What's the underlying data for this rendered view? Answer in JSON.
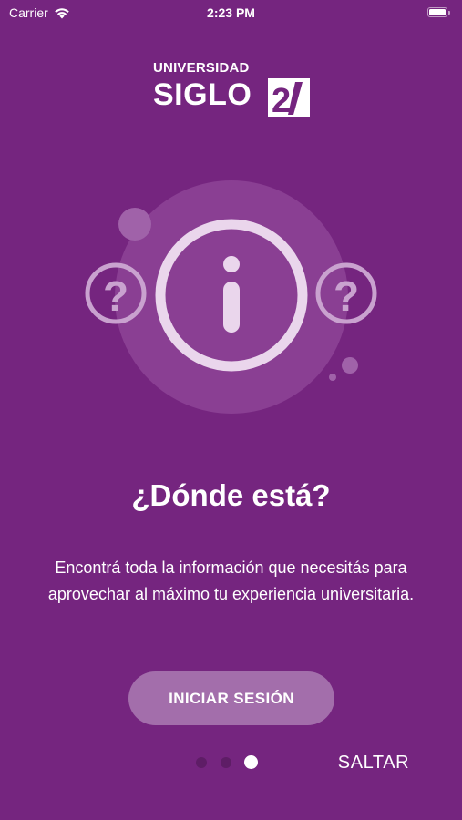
{
  "status_bar": {
    "carrier": "Carrier",
    "time": "2:23 PM",
    "wifi_icon": "wifi-icon",
    "battery_icon": "battery-icon"
  },
  "logo": {
    "line1": "UNIVERSIDAD",
    "line2": "SIGLO",
    "badge": "21"
  },
  "illustration": {
    "center_icon": "info-icon",
    "side_icons": [
      "question-icon",
      "question-icon"
    ]
  },
  "slide": {
    "title": "¿Dónde está?",
    "description": "Encontrá toda la información que necesitás para aprovechar al máximo tu experiencia universitaria."
  },
  "actions": {
    "login_label": "INICIAR SESIÓN",
    "skip_label": "SALTAR"
  },
  "pagination": {
    "total": 3,
    "current": 3
  },
  "colors": {
    "background": "#75257f",
    "button": "#a36eab",
    "dot_inactive": "#5e1d66",
    "dot_active": "#ffffff"
  }
}
